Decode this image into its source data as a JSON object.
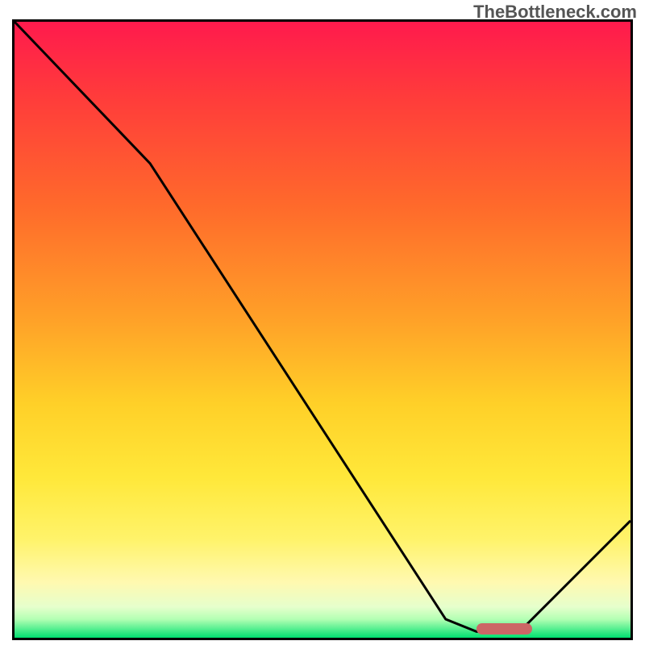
{
  "watermark": "TheBottleneck.com",
  "chart_data": {
    "type": "line",
    "title": "",
    "xlabel": "",
    "ylabel": "",
    "xlim": [
      0,
      100
    ],
    "ylim": [
      0,
      100
    ],
    "curve": {
      "x": [
        0,
        22,
        70,
        75,
        82,
        100
      ],
      "values": [
        100,
        77,
        3,
        1,
        1,
        19
      ]
    },
    "gradient_stops": [
      {
        "pct": 0,
        "color": "#ff1a4d"
      },
      {
        "pct": 12,
        "color": "#ff3b3b"
      },
      {
        "pct": 30,
        "color": "#ff6a2b"
      },
      {
        "pct": 48,
        "color": "#ffa028"
      },
      {
        "pct": 62,
        "color": "#ffd028"
      },
      {
        "pct": 74,
        "color": "#ffe83a"
      },
      {
        "pct": 84,
        "color": "#fff36a"
      },
      {
        "pct": 91,
        "color": "#fff9b0"
      },
      {
        "pct": 95,
        "color": "#e6ffcc"
      },
      {
        "pct": 97,
        "color": "#b3ffb3"
      },
      {
        "pct": 100,
        "color": "#00e070"
      }
    ],
    "marker": {
      "x_start": 75,
      "x_end": 84,
      "y": 1.5,
      "color": "#cc6666"
    }
  }
}
